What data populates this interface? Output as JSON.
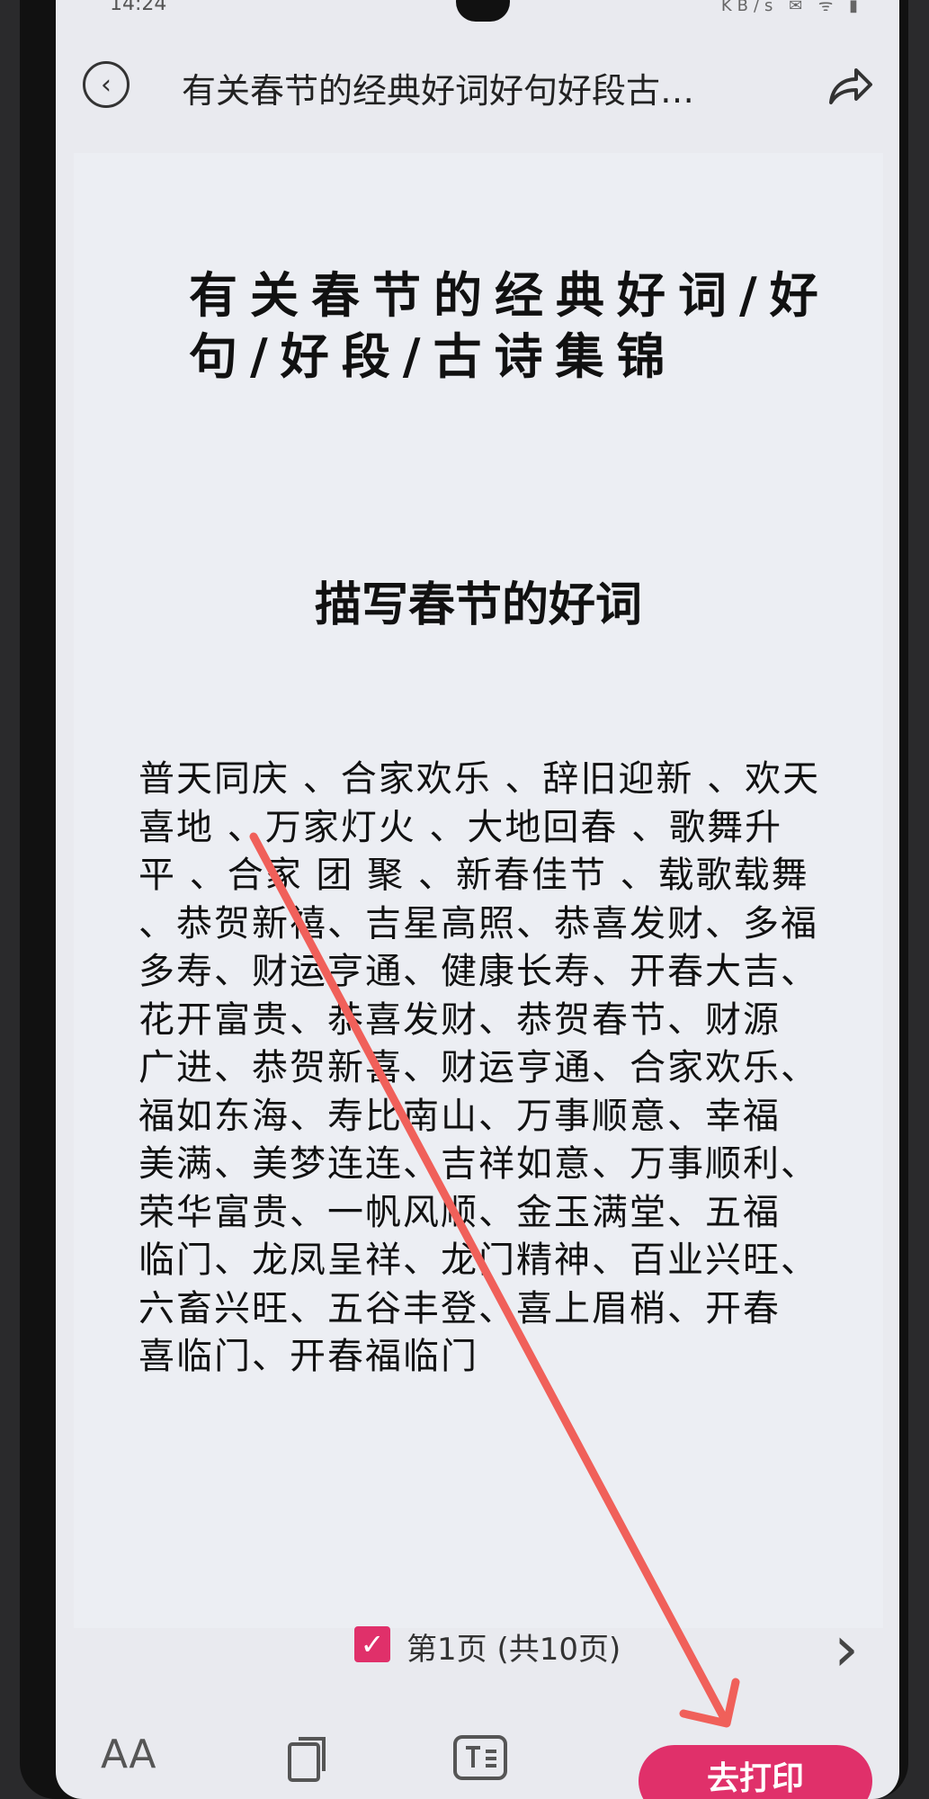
{
  "status": {
    "time": "14:24",
    "icons": "KB/s ✉ ᯤ ▮"
  },
  "header": {
    "title": "有关春节的经典好词好句好段古…"
  },
  "document": {
    "title": "有关春节的经典好词/好句/好段/古诗集锦",
    "section_heading": "描写春节的好词",
    "body": "普天同庆 、合家欢乐 、辞旧迎新 、欢天喜地 、万家灯火 、大地回春 、歌舞升 平 、合家 团 聚 、新春佳节 、载歌载舞 、恭贺新禧、吉星高照、恭喜发财、多福 多寿、财运亨通、健康长寿、开春大吉、花开富贵、恭喜发财、恭贺春节、财源 广进、恭贺新喜、财运亨通、合家欢乐、福如东海、寿比南山、万事顺意、幸福 美满、美梦连连、吉祥如意、万事顺利、荣华富贵、一帆风顺、金玉满堂、五福 临门、龙凤呈祥、龙门精神、百业兴旺、六畜兴旺、五谷丰登、喜上眉梢、开春 喜临门、开春福临门"
  },
  "pager": {
    "checkbox_mark": "✓",
    "label": "第1页 (共10页)",
    "next": "›"
  },
  "toolbar": {
    "font_icon": "AA",
    "print_label": "去打印"
  },
  "colors": {
    "accent": "#e0306a",
    "annotation": "#f0605a"
  }
}
